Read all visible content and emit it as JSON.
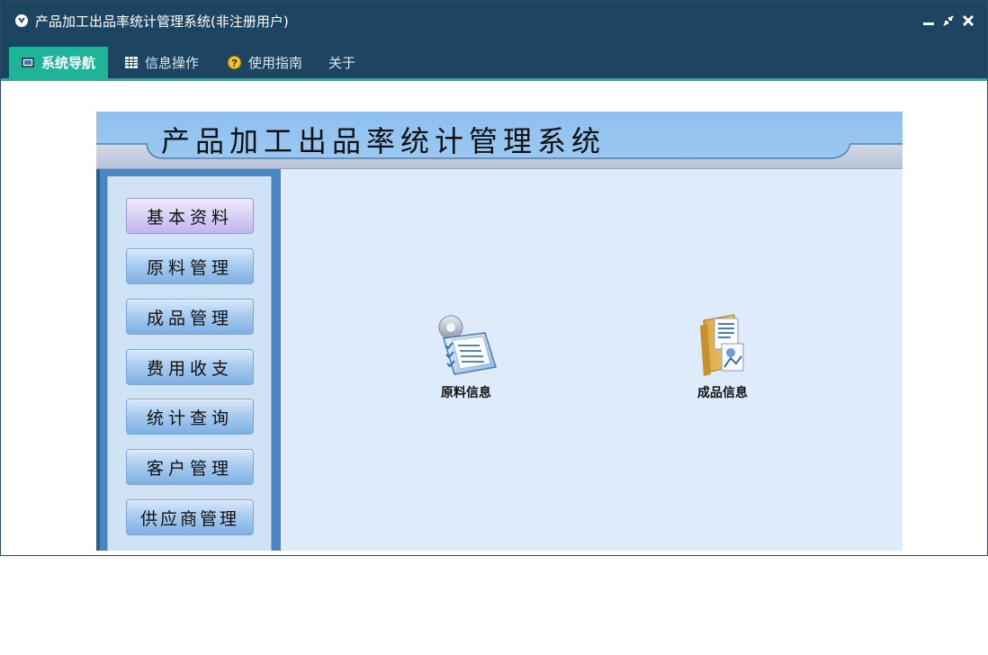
{
  "window": {
    "title": "产品加工出品率统计管理系统(非注册用户)"
  },
  "menubar": {
    "items": [
      {
        "label": "系统导航",
        "icon": "monitor-icon",
        "active": true
      },
      {
        "label": "信息操作",
        "icon": "grid-icon",
        "active": false
      },
      {
        "label": "使用指南",
        "icon": "help-icon",
        "active": false
      },
      {
        "label": "关于",
        "icon": "",
        "active": false
      }
    ]
  },
  "banner": {
    "title": "产品加工出品率统计管理系统"
  },
  "sidebar": {
    "items": [
      {
        "label": "基本资料",
        "active": true
      },
      {
        "label": "原料管理",
        "active": false
      },
      {
        "label": "成品管理",
        "active": false
      },
      {
        "label": "费用收支",
        "active": false
      },
      {
        "label": "统计查询",
        "active": false
      },
      {
        "label": "客户管理",
        "active": false
      },
      {
        "label": "供应商管理",
        "active": false
      }
    ]
  },
  "main": {
    "tiles": [
      {
        "label": "原料信息",
        "icon": "clipboard-gear-icon"
      },
      {
        "label": "成品信息",
        "icon": "folder-document-icon"
      }
    ]
  },
  "colors": {
    "titlebar": "#1d4461",
    "accent": "#1fb39a",
    "panel_bg": "#deebfb"
  }
}
